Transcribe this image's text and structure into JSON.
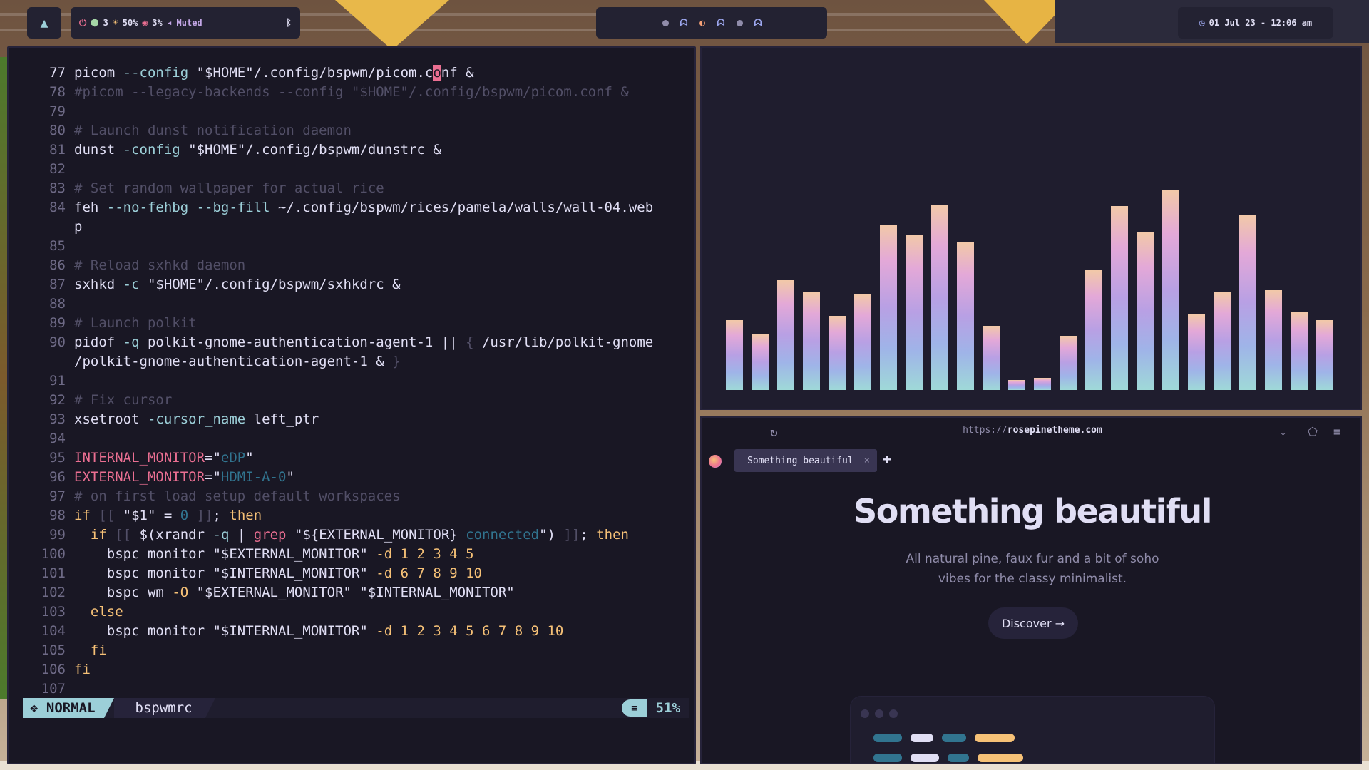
{
  "topbar": {
    "launcher_icon": "arch-logo-icon",
    "status": {
      "updates": "3",
      "brightness": "50%",
      "cpu": "3%",
      "volume": "Muted"
    },
    "workspaces": [
      "dot",
      "ghost",
      "pacman",
      "ghost",
      "dot",
      "ghost"
    ],
    "clock": "01 Jul 23 - 12:06 am",
    "colors": {
      "bar_bg": "#232232",
      "accent": "#9ccfd8",
      "love": "#eb6f92",
      "gold": "#f6c177",
      "iris": "#c4a7e7"
    }
  },
  "editor": {
    "mode": "NORMAL",
    "filename": "bspwmrc",
    "percent": "51%",
    "lines": [
      {
        "n": "77",
        "parts": [
          [
            "t",
            "picom "
          ],
          [
            "f",
            "--config "
          ],
          [
            "s",
            "\"$HOME\"/.config/bspwm/picom.c"
          ],
          [
            "cur",
            "o"
          ],
          [
            "s",
            "nf &"
          ]
        ]
      },
      {
        "n": "78",
        "parts": [
          [
            "c",
            "#picom --legacy-backends --config \"$HOME\"/.config/bspwm/picom.conf &"
          ]
        ]
      },
      {
        "n": "79",
        "parts": []
      },
      {
        "n": "80",
        "parts": [
          [
            "c",
            "# Launch dunst notification daemon"
          ]
        ]
      },
      {
        "n": "81",
        "parts": [
          [
            "t",
            "dunst "
          ],
          [
            "f",
            "-config "
          ],
          [
            "s",
            "\"$HOME\"/.config/bspwm/dunstrc &"
          ]
        ]
      },
      {
        "n": "82",
        "parts": []
      },
      {
        "n": "83",
        "parts": [
          [
            "c",
            "# Set random wallpaper for actual rice"
          ]
        ]
      },
      {
        "n": "84",
        "parts": [
          [
            "t",
            "feh "
          ],
          [
            "f",
            "--no-fehbg --bg-fill "
          ],
          [
            "t",
            "~/.config/bspwm/rices/pamela/walls/wall-04.web"
          ]
        ]
      },
      {
        "n": "",
        "parts": [
          [
            "t",
            "p"
          ]
        ]
      },
      {
        "n": "85",
        "parts": []
      },
      {
        "n": "86",
        "parts": [
          [
            "c",
            "# Reload sxhkd daemon"
          ]
        ]
      },
      {
        "n": "87",
        "parts": [
          [
            "t",
            "sxhkd "
          ],
          [
            "f",
            "-c "
          ],
          [
            "s",
            "\"$HOME\"/.config/bspwm/sxhkdrc &"
          ]
        ]
      },
      {
        "n": "88",
        "parts": []
      },
      {
        "n": "89",
        "parts": [
          [
            "c",
            "# Launch polkit"
          ]
        ]
      },
      {
        "n": "90",
        "parts": [
          [
            "t",
            "pidof "
          ],
          [
            "f",
            "-q "
          ],
          [
            "t",
            "polkit-gnome-authentication-agent-1 || "
          ],
          [
            "c",
            "{ "
          ],
          [
            "t",
            "/usr/lib/polkit-gnome"
          ]
        ]
      },
      {
        "n": "",
        "parts": [
          [
            "t",
            "/polkit-gnome-authentication-agent-1 & "
          ],
          [
            "c",
            "}"
          ]
        ]
      },
      {
        "n": "91",
        "parts": []
      },
      {
        "n": "92",
        "parts": [
          [
            "c",
            "# Fix cursor"
          ]
        ]
      },
      {
        "n": "93",
        "parts": [
          [
            "t",
            "xsetroot "
          ],
          [
            "f",
            "-cursor_name "
          ],
          [
            "t",
            "left_ptr"
          ]
        ]
      },
      {
        "n": "94",
        "parts": []
      },
      {
        "n": "95",
        "parts": [
          [
            "v",
            "INTERNAL_MONITOR"
          ],
          [
            "t",
            "=\""
          ],
          [
            "sv",
            "eDP"
          ],
          [
            "t",
            "\""
          ]
        ]
      },
      {
        "n": "96",
        "parts": [
          [
            "v",
            "EXTERNAL_MONITOR"
          ],
          [
            "t",
            "=\""
          ],
          [
            "sv",
            "HDMI-A-0"
          ],
          [
            "t",
            "\""
          ]
        ]
      },
      {
        "n": "97",
        "parts": [
          [
            "c",
            "# on first load setup default workspaces"
          ]
        ]
      },
      {
        "n": "98",
        "parts": [
          [
            "k",
            "if "
          ],
          [
            "c",
            "[[ "
          ],
          [
            "t",
            "\"$1\" = "
          ],
          [
            "sv",
            "0"
          ],
          [
            "c",
            " ]]"
          ],
          [
            "t",
            "; "
          ],
          [
            "k",
            "then"
          ]
        ]
      },
      {
        "n": "99",
        "parts": [
          [
            "t",
            "  "
          ],
          [
            "k",
            "if "
          ],
          [
            "c",
            "[[ "
          ],
          [
            "t",
            "$(xrandr "
          ],
          [
            "f",
            "-q "
          ],
          [
            "t",
            "| "
          ],
          [
            "v",
            "grep "
          ],
          [
            "t",
            "\"${EXTERNAL_MONITOR} "
          ],
          [
            "sv",
            "connected"
          ],
          [
            "t",
            "\") "
          ],
          [
            "c",
            "]]"
          ],
          [
            "t",
            "; "
          ],
          [
            "k",
            "then"
          ]
        ]
      },
      {
        "n": "100",
        "parts": [
          [
            "t",
            "    bspc monitor \"$EXTERNAL_MONITOR\" "
          ],
          [
            "a",
            "-d 1 2 3 4 5"
          ]
        ]
      },
      {
        "n": "101",
        "parts": [
          [
            "t",
            "    bspc monitor \"$INTERNAL_MONITOR\" "
          ],
          [
            "a",
            "-d 6 7 8 9 10"
          ]
        ]
      },
      {
        "n": "102",
        "parts": [
          [
            "t",
            "    bspc wm "
          ],
          [
            "a",
            "-O "
          ],
          [
            "t",
            "\"$EXTERNAL_MONITOR\" \"$INTERNAL_MONITOR\""
          ]
        ]
      },
      {
        "n": "103",
        "parts": [
          [
            "t",
            "  "
          ],
          [
            "k",
            "else"
          ]
        ]
      },
      {
        "n": "104",
        "parts": [
          [
            "t",
            "    bspc monitor \"$INTERNAL_MONITOR\" "
          ],
          [
            "a",
            "-d 1 2 3 4 5 6 7 8 9 10"
          ]
        ]
      },
      {
        "n": "105",
        "parts": [
          [
            "t",
            "  "
          ],
          [
            "k",
            "fi"
          ]
        ]
      },
      {
        "n": "106",
        "parts": [
          [
            "k",
            "fi"
          ]
        ]
      },
      {
        "n": "107",
        "parts": []
      }
    ]
  },
  "visualizer": {
    "levels": [
      0.35,
      0.28,
      0.55,
      0.49,
      0.37,
      0.48,
      0.83,
      0.78,
      0.93,
      0.74,
      0.32,
      0.05,
      0.06,
      0.27,
      0.6,
      0.92,
      0.79,
      1.0,
      0.38,
      0.49,
      0.88,
      0.5,
      0.39,
      0.35
    ]
  },
  "browser": {
    "url_scheme": "https://",
    "url_host": "rosepinetheme.com",
    "tab_title": "Something beautiful",
    "hero_title": "Something beautiful",
    "hero_subtitle": "All natural pine, faux fur and a bit of soho vibes for the classy minimalist.",
    "discover_label": "Discover →"
  }
}
